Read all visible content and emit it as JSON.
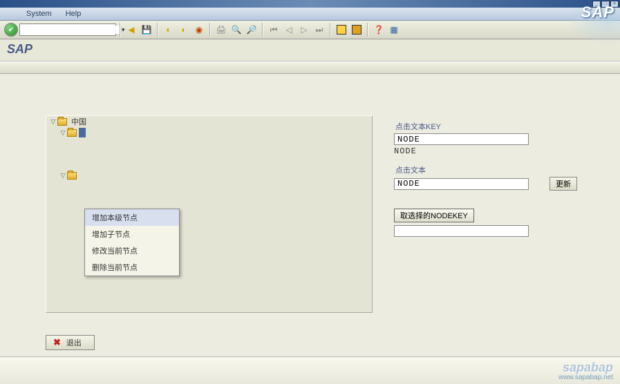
{
  "menubar": {
    "items": [
      "System",
      "Help"
    ]
  },
  "app_title": "SAP",
  "tree": {
    "root": "中国",
    "context_items": [
      "增加本级节点",
      "增加子节点",
      "修改当前节点",
      "删除当前节点"
    ]
  },
  "form": {
    "key_label": "点击文本KEY",
    "key_value": "NODE",
    "key_readonly": "NODE",
    "text_label": "点击文本",
    "text_value": "NODE",
    "update_btn": "更新",
    "get_sel_btn": "取选择的NODEKEY",
    "sel_value": ""
  },
  "exit_label": "退出",
  "watermark": {
    "brand": "sapabap",
    "url": "www.sapabap.net"
  }
}
